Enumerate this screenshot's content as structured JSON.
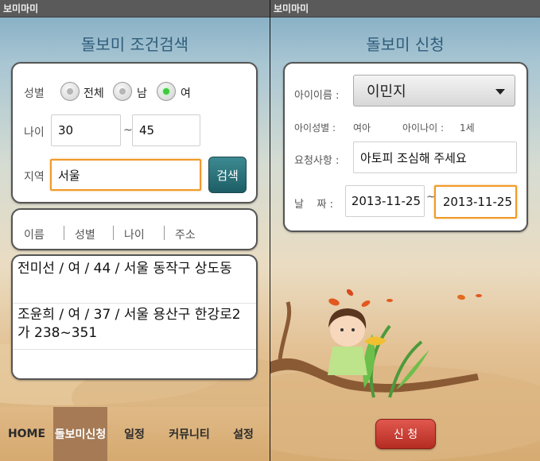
{
  "left": {
    "status_title": "보미마미",
    "title": "돌보미 조건검색",
    "gender_label": "성별",
    "gender_options": [
      "전체",
      "남",
      "여"
    ],
    "selected_gender": "여",
    "age_label": "나이",
    "age_min": "30",
    "age_sep": "~",
    "age_max": "45",
    "region_label": "지역",
    "region_value": "서울",
    "search_button": "검색",
    "headers": [
      "이름",
      "성별",
      "나이",
      "주소"
    ],
    "results": [
      "전미선 / 여 / 44 / 서울 동작구 상도동",
      "조윤희 / 여 / 37 / 서울 용산구 한강로2가 238~351"
    ],
    "tabs": [
      "HOME",
      "돌보미신청",
      "일정",
      "커뮤니티",
      "설정"
    ],
    "active_tab": "돌보미신청"
  },
  "right": {
    "status_title": "보미마미",
    "title": "돌보미 신청",
    "child_name_label": "아이이름 :",
    "child_name_value": "이민지",
    "child_gender_label": "아이성별 :",
    "child_gender_value": "여아",
    "child_age_label": "아이나이 :",
    "child_age_value": "1세",
    "request_label": "요청사항 :",
    "request_value": "아토피 조심해 주세요",
    "date_label": "날    짜 :",
    "date_start": "2013-11-25",
    "date_sep": "~",
    "date_end": "2013-11-25",
    "apply_button": "신 청"
  },
  "colors": {
    "title": "#2f5d7a",
    "focus_border": "#f09a2a",
    "search_button": "#2a7078",
    "active_tab": "#a57a55",
    "apply_button": "#c83a30",
    "radio_on": "#3fc93f"
  }
}
